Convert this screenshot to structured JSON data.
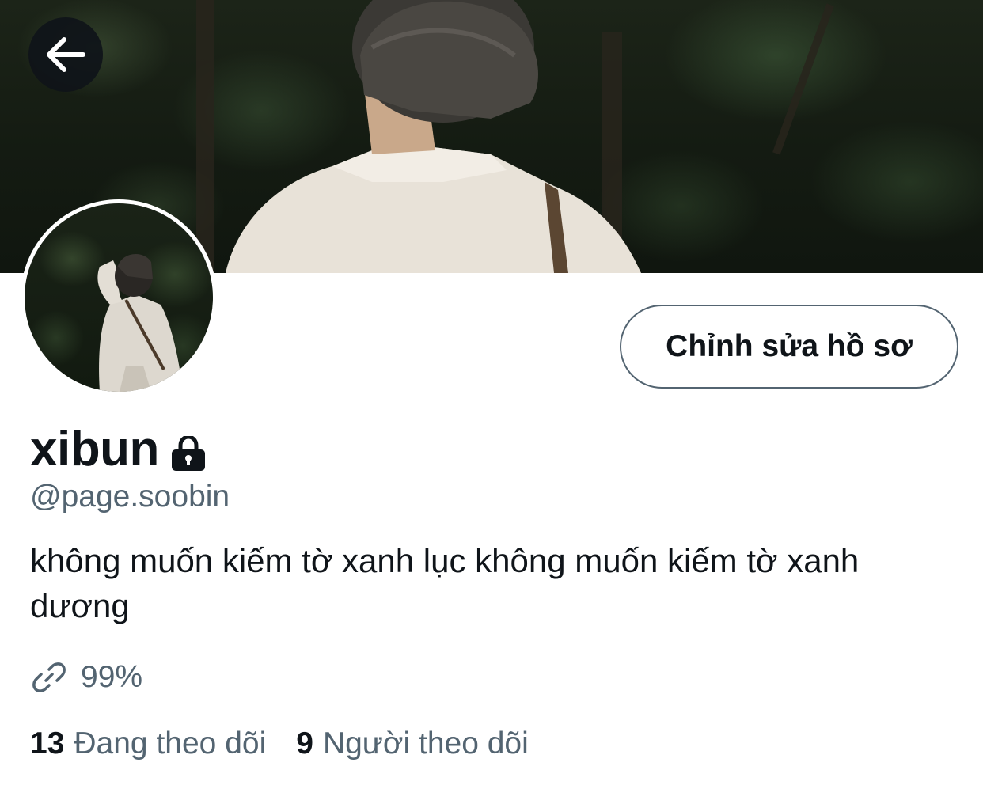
{
  "profile": {
    "display_name": "xibun",
    "handle": "@page.soobin",
    "bio": "không muốn kiếm tờ xanh lục không muốn kiếm tờ xanh dương",
    "link": "99%",
    "edit_button_label": "Chỉnh sửa hồ sơ",
    "protected": true
  },
  "stats": {
    "following_count": "13",
    "following_label": "Đang theo dõi",
    "followers_count": "9",
    "followers_label": "Người theo dõi"
  },
  "icons": {
    "back": "arrow-left-icon",
    "lock": "lock-icon",
    "link": "link-icon"
  },
  "colors": {
    "text_primary": "#0f1419",
    "text_secondary": "#536471",
    "background": "#ffffff",
    "button_border": "#536471"
  }
}
